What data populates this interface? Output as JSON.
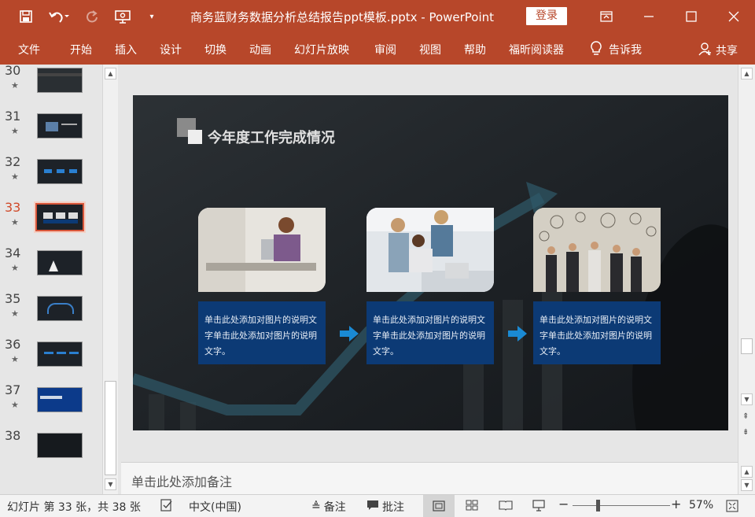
{
  "titlebar": {
    "doc_title": "商务蓝财务数据分析总结报告ppt模板.pptx  -  PowerPoint",
    "login_label": "登录",
    "qat_icons": [
      "save-icon",
      "undo-icon",
      "redo-icon",
      "present-from-start-icon",
      "customize-qat-icon"
    ]
  },
  "ribbon": {
    "tabs": [
      "文件",
      "开始",
      "插入",
      "设计",
      "切换",
      "动画",
      "幻灯片放映",
      "审阅",
      "视图",
      "帮助",
      "福昕阅读器",
      "告诉我"
    ],
    "share_label": "共享"
  },
  "thumbnails": [
    {
      "num": "30",
      "star": "★"
    },
    {
      "num": "31",
      "star": "★"
    },
    {
      "num": "32",
      "star": "★"
    },
    {
      "num": "33",
      "star": "★",
      "selected": true
    },
    {
      "num": "34",
      "star": "★"
    },
    {
      "num": "35",
      "star": "★"
    },
    {
      "num": "36",
      "star": "★"
    },
    {
      "num": "37",
      "star": "★"
    },
    {
      "num": "38",
      "star": ""
    }
  ],
  "slide": {
    "title": "今年度工作完成情况",
    "cards": [
      {
        "text": "单击此处添加对图片的说明文字单击此处添加对图片的说明文字。"
      },
      {
        "text": "单击此处添加对图片的说明文字单击此处添加对图片的说明文字。"
      },
      {
        "text": "单击此处添加对图片的说明文字单击此处添加对图片的说明文字。"
      }
    ]
  },
  "notes": {
    "placeholder": "单击此处添加备注"
  },
  "status": {
    "slide_info": "幻灯片 第 33 张，共 38 张",
    "language": "中文(中国)",
    "notes_label": "备注",
    "comments_label": "批注",
    "zoom": "57%"
  },
  "colors": {
    "ribbon": "#b7472a",
    "card_box": "#0c3a75",
    "arrow": "#1a8ad4"
  }
}
